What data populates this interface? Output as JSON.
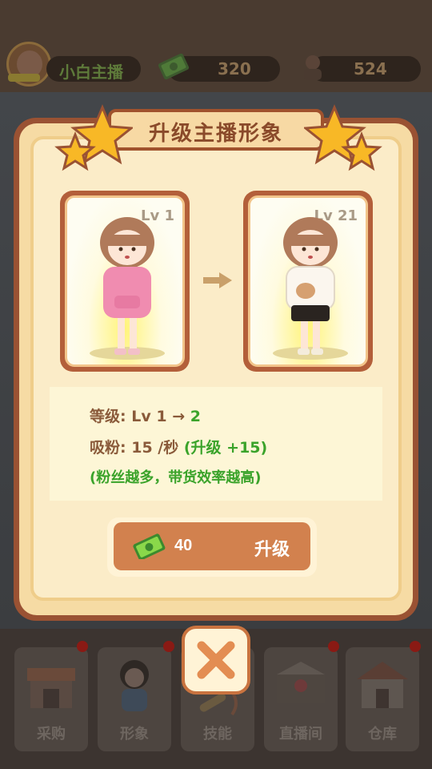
{
  "hud": {
    "streamer_name": "小白主播",
    "money": "320",
    "fans": "524"
  },
  "popup": {
    "title": "升级主播形象",
    "current_card": {
      "level": "Lv 1"
    },
    "next_card": {
      "level": "Lv 21"
    },
    "info": {
      "level_label": "等级:",
      "level_from": "Lv 1",
      "level_arrow": "→",
      "level_to": "2",
      "fans_label": "吸粉:",
      "fans_rate": "15 /秒",
      "fans_bonus": "(升级 +15)",
      "note": "(粉丝越多，带货效率越高)"
    },
    "upgrade_button": {
      "cost": "40",
      "label": "升级"
    }
  },
  "tabs": [
    {
      "label": "采购"
    },
    {
      "label": "形象"
    },
    {
      "label": "技能"
    },
    {
      "label": "直播间"
    },
    {
      "label": "仓库"
    }
  ],
  "colors": {
    "accent_brown": "#9a5233",
    "button_orange": "#d2814e",
    "green_text": "#3aa32a"
  }
}
